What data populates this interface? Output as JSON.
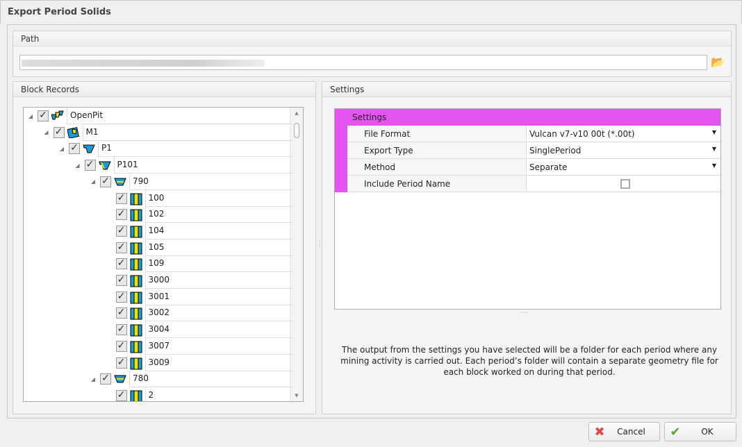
{
  "window": {
    "title": "Export Period Solids"
  },
  "path": {
    "label": "Path",
    "value": ""
  },
  "block_records": {
    "label": "Block Records",
    "tree": [
      {
        "label": "OpenPit",
        "level": 0,
        "icon": "openpit-icon",
        "expanded": true,
        "checked": true
      },
      {
        "label": "M1",
        "level": 1,
        "icon": "mine-icon",
        "expanded": true,
        "checked": true
      },
      {
        "label": "P1",
        "level": 2,
        "icon": "pit-icon",
        "expanded": true,
        "checked": true
      },
      {
        "label": "P101",
        "level": 3,
        "icon": "pit-phase-icon",
        "expanded": true,
        "checked": true
      },
      {
        "label": "790",
        "level": 4,
        "icon": "bench-icon",
        "expanded": true,
        "checked": true
      },
      {
        "label": "100",
        "level": 5,
        "icon": "block-icon",
        "checked": true
      },
      {
        "label": "102",
        "level": 5,
        "icon": "block-icon",
        "checked": true
      },
      {
        "label": "104",
        "level": 5,
        "icon": "block-icon",
        "checked": true
      },
      {
        "label": "105",
        "level": 5,
        "icon": "block-icon",
        "checked": true
      },
      {
        "label": "109",
        "level": 5,
        "icon": "block-icon",
        "checked": true
      },
      {
        "label": "3000",
        "level": 5,
        "icon": "block-icon",
        "checked": true
      },
      {
        "label": "3001",
        "level": 5,
        "icon": "block-icon",
        "checked": true
      },
      {
        "label": "3002",
        "level": 5,
        "icon": "block-icon",
        "checked": true
      },
      {
        "label": "3004",
        "level": 5,
        "icon": "block-icon",
        "checked": true
      },
      {
        "label": "3007",
        "level": 5,
        "icon": "block-icon",
        "checked": true
      },
      {
        "label": "3009",
        "level": 5,
        "icon": "block-icon",
        "checked": true
      },
      {
        "label": "780",
        "level": 4,
        "icon": "bench-icon",
        "expanded": true,
        "checked": true
      },
      {
        "label": "2",
        "level": 5,
        "icon": "block-icon",
        "checked": true
      }
    ]
  },
  "settings": {
    "label": "Settings",
    "category": "Settings",
    "rows": [
      {
        "name": "File Format",
        "value": "Vulcan v7-v10 00t (*.00t)",
        "type": "dropdown"
      },
      {
        "name": "Export Type",
        "value": "SinglePeriod",
        "type": "dropdown"
      },
      {
        "name": "Method",
        "value": "Separate",
        "type": "dropdown"
      },
      {
        "name": "Include Period Name",
        "value": false,
        "type": "checkbox"
      }
    ],
    "description": "The output from the settings you have selected will be a folder for each period where any mining activity is carried out. Each period’s folder will contain a separate geometry file for each block worked on during that period."
  },
  "buttons": {
    "cancel": "Cancel",
    "ok": "OK"
  },
  "colors": {
    "category": "#e455f0"
  }
}
